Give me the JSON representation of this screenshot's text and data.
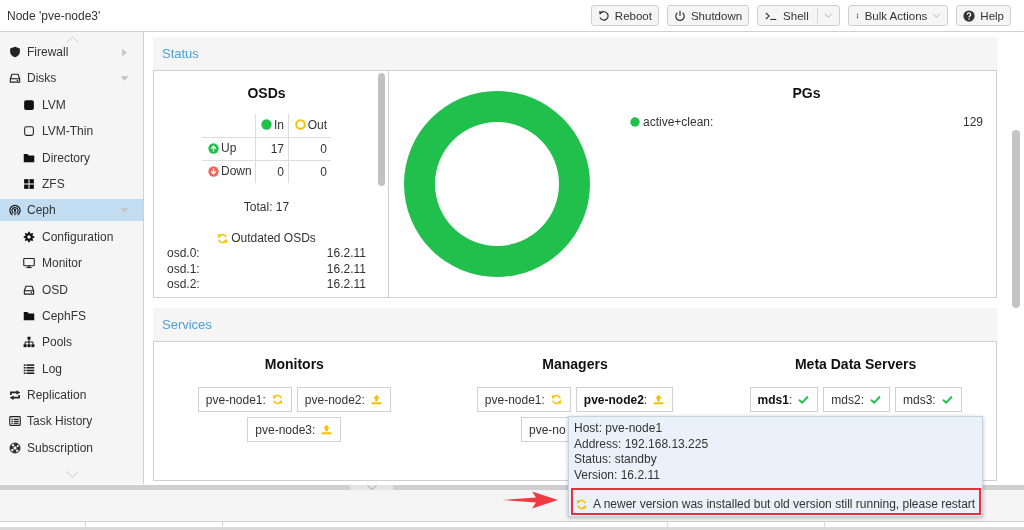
{
  "header": {
    "title": "Node 'pve-node3'",
    "buttons": [
      {
        "label": "Reboot",
        "kind": "plain"
      },
      {
        "label": "Shutdown",
        "kind": "plain"
      },
      {
        "label": "Shell",
        "kind": "split"
      },
      {
        "label": "Bulk Actions",
        "kind": "menu"
      },
      {
        "label": "Help",
        "kind": "plain"
      }
    ]
  },
  "sidebar": {
    "items": [
      {
        "label": "Firewall",
        "kind": "group",
        "expanded": false,
        "selected": false
      },
      {
        "label": "Disks",
        "kind": "group",
        "expanded": true,
        "selected": false,
        "children": [
          {
            "label": "LVM",
            "selected": false
          },
          {
            "label": "LVM-Thin",
            "selected": false
          },
          {
            "label": "Directory",
            "selected": false
          },
          {
            "label": "ZFS",
            "selected": false
          }
        ]
      },
      {
        "label": "Ceph",
        "kind": "group",
        "expanded": true,
        "selected": true,
        "children": [
          {
            "label": "Configuration",
            "selected": false
          },
          {
            "label": "Monitor",
            "selected": false
          },
          {
            "label": "OSD",
            "selected": false
          },
          {
            "label": "CephFS",
            "selected": false
          },
          {
            "label": "Pools",
            "selected": false
          },
          {
            "label": "Log",
            "selected": false
          }
        ]
      },
      {
        "label": "Replication",
        "kind": "item",
        "selected": false
      },
      {
        "label": "Task History",
        "kind": "item",
        "selected": false
      },
      {
        "label": "Subscription",
        "kind": "item",
        "selected": false
      }
    ]
  },
  "status": {
    "title": "Status",
    "osds": {
      "title": "OSDs",
      "columns": [
        {
          "label": "In",
          "kind": "filled",
          "color": "#21bf4b"
        },
        {
          "label": "Out",
          "kind": "ring",
          "color": "#f5c400"
        }
      ],
      "rows": [
        {
          "label": "Up",
          "kind": "up",
          "color": "#21bf4b",
          "values": [
            "17",
            "0"
          ]
        },
        {
          "label": "Down",
          "kind": "down",
          "color": "#f0685c",
          "values": [
            "0",
            "0"
          ]
        }
      ],
      "total": "Total: 17",
      "outdated_title": "Outdated OSDs",
      "outdated": [
        {
          "name": "osd.0:",
          "version": "16.2.11"
        },
        {
          "name": "osd.1:",
          "version": "16.2.11"
        },
        {
          "name": "osd.2:",
          "version": "16.2.11"
        }
      ]
    },
    "pgs": {
      "title": "PGs",
      "legend": [
        {
          "label": "active+clean:",
          "value": "129",
          "color": "#21bf4b"
        }
      ]
    }
  },
  "services": {
    "title": "Services",
    "groups": [
      {
        "title": "Monitors",
        "items": [
          {
            "label": "pve-node1:",
            "kind": "outdated"
          },
          {
            "label": "pve-node2:",
            "kind": "upgrade"
          },
          {
            "label": "pve-node3:",
            "kind": "upgrade"
          }
        ]
      },
      {
        "title": "Managers",
        "items": [
          {
            "label": "pve-node1:",
            "kind": "outdated"
          },
          {
            "label": "**pve-node2**:",
            "kind": "upgrade"
          },
          {
            "label": "pve-no",
            "kind": "cut"
          }
        ]
      },
      {
        "title": "Meta Data Servers",
        "items": [
          {
            "label": "**mds1**:",
            "kind": "ok"
          },
          {
            "label": "mds2:",
            "kind": "ok"
          },
          {
            "label": "mds3:",
            "kind": "ok"
          }
        ]
      }
    ]
  },
  "tooltip": {
    "lines": [
      "Host: pve-node1",
      "Address: 192.168.13.225",
      "Status: standby",
      "Version: 16.2.11"
    ],
    "warning": {
      "text": "A newer version was installed but old version still running, please restart",
      "highlighted": true
    }
  }
}
